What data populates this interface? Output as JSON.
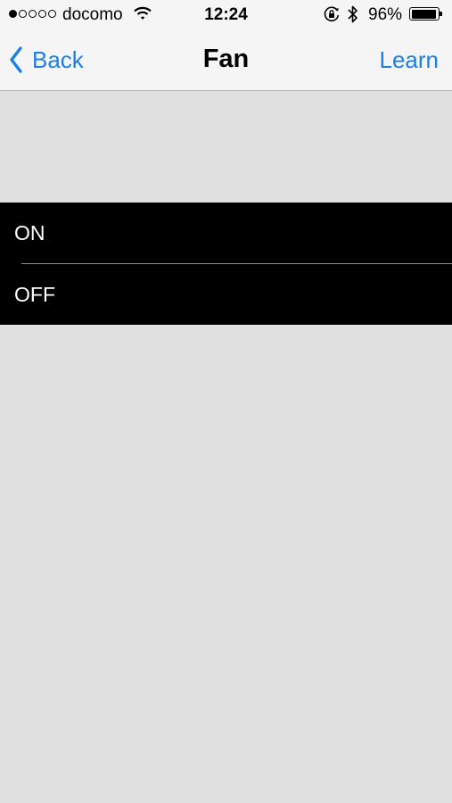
{
  "status_bar": {
    "signal_filled": 1,
    "signal_total": 5,
    "carrier": "docomo",
    "time": "12:24",
    "battery_percent": "96%",
    "battery_level": 0.96
  },
  "nav": {
    "back_label": "Back",
    "title": "Fan",
    "learn_label": "Learn"
  },
  "commands": [
    {
      "label": "ON"
    },
    {
      "label": "OFF"
    }
  ],
  "colors": {
    "accent": "#1a7fe8",
    "background": "#e0e0e0",
    "list_background": "#000000",
    "list_text": "#ffffff"
  },
  "icons": [
    "wifi-icon",
    "rotation-lock-icon",
    "bluetooth-icon",
    "battery-icon",
    "chevron-left-icon"
  ]
}
